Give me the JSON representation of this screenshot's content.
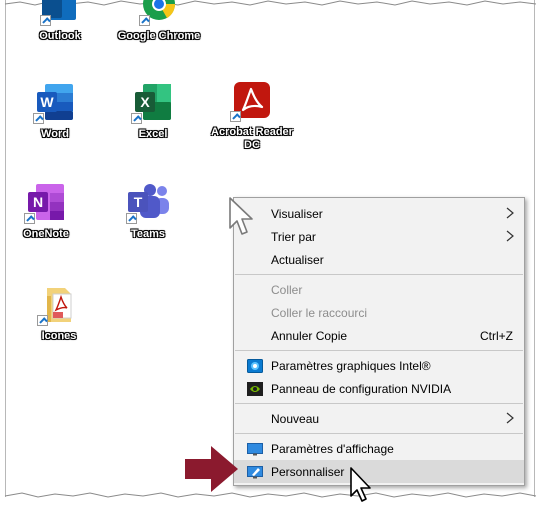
{
  "desktop": {
    "icons": [
      {
        "label": "Outlook",
        "icon": "outlook-icon"
      },
      {
        "label": "Google Chrome",
        "icon": "chrome-icon"
      },
      {
        "label": "Word",
        "icon": "word-icon"
      },
      {
        "label": "Excel",
        "icon": "excel-icon"
      },
      {
        "label": "Acrobat Reader DC",
        "icon": "acrobat-icon"
      },
      {
        "label": "OneNote",
        "icon": "onenote-icon"
      },
      {
        "label": "Teams",
        "icon": "teams-icon"
      },
      {
        "label": "Icones",
        "icon": "folder-icon"
      }
    ]
  },
  "context_menu": {
    "items": [
      {
        "label": "Visualiser",
        "submenu": true
      },
      {
        "label": "Trier par",
        "submenu": true
      },
      {
        "label": "Actualiser"
      },
      {
        "label": "Coller",
        "disabled": true
      },
      {
        "label": "Coller le raccourci",
        "disabled": true
      },
      {
        "label": "Annuler Copie",
        "shortcut": "Ctrl+Z"
      },
      {
        "label": "Paramètres graphiques Intel®",
        "icon": "intel-graphics-icon"
      },
      {
        "label": "Panneau de configuration NVIDIA",
        "icon": "nvidia-icon"
      },
      {
        "label": "Nouveau",
        "submenu": true
      },
      {
        "label": "Paramètres d'affichage",
        "icon": "display-settings-icon"
      },
      {
        "label": "Personnaliser",
        "icon": "personalize-icon",
        "highlighted": true
      }
    ]
  },
  "colors": {
    "menu_bg": "#f2f2f2",
    "menu_hover": "#dadada",
    "annotation_arrow": "#8b1a2e",
    "word_blue": "#2b579a",
    "excel_green": "#217346",
    "acrobat_red": "#c1170e",
    "onenote_purple": "#7719aa",
    "teams_purple": "#5558af"
  }
}
